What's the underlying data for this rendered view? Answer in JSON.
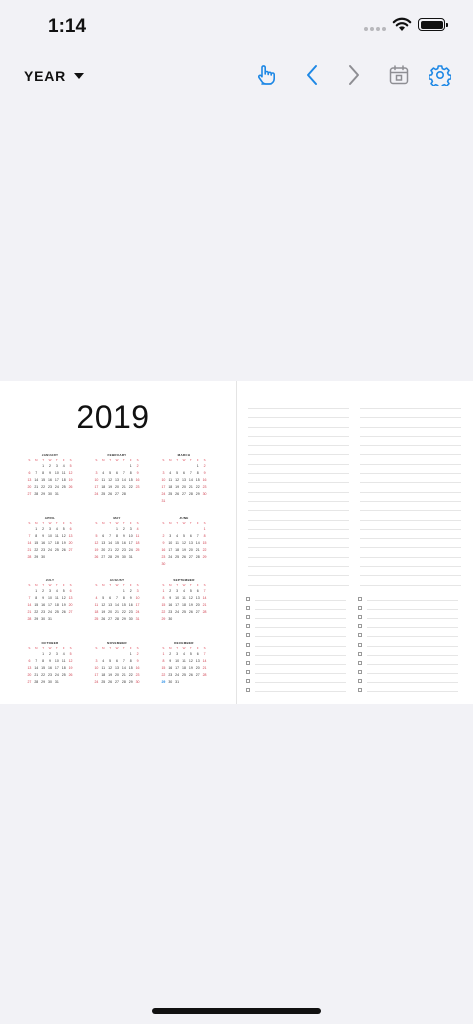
{
  "status": {
    "time": "1:14"
  },
  "toolbar": {
    "view_label": "YEAR",
    "icons": {
      "touch": "hand-pointer-icon",
      "prev": "chevron-left-icon",
      "next": "chevron-right-icon",
      "calendar": "calendar-icon",
      "settings": "gear-icon"
    },
    "accent": "#1e88e5"
  },
  "planner": {
    "year": "2019",
    "weekday_letters": [
      "S",
      "M",
      "T",
      "W",
      "T",
      "F",
      "S"
    ],
    "today": {
      "month": 11,
      "day": 29
    },
    "months": [
      {
        "name": "JANUARY",
        "first_weekday": 2,
        "days": 31
      },
      {
        "name": "FEBRUARY",
        "first_weekday": 5,
        "days": 28
      },
      {
        "name": "MARCH",
        "first_weekday": 5,
        "days": 31
      },
      {
        "name": "APRIL",
        "first_weekday": 1,
        "days": 30
      },
      {
        "name": "MAY",
        "first_weekday": 3,
        "days": 31
      },
      {
        "name": "JUNE",
        "first_weekday": 6,
        "days": 30
      },
      {
        "name": "JULY",
        "first_weekday": 1,
        "days": 31
      },
      {
        "name": "AUGUST",
        "first_weekday": 4,
        "days": 31
      },
      {
        "name": "SEPTEMBER",
        "first_weekday": 0,
        "days": 30
      },
      {
        "name": "OCTOBER",
        "first_weekday": 2,
        "days": 31
      },
      {
        "name": "NOVEMBER",
        "first_weekday": 5,
        "days": 30
      },
      {
        "name": "DECEMBER",
        "first_weekday": 0,
        "days": 31
      }
    ],
    "notes_lines_per_column": 20,
    "todo_rows_per_column": 11
  }
}
